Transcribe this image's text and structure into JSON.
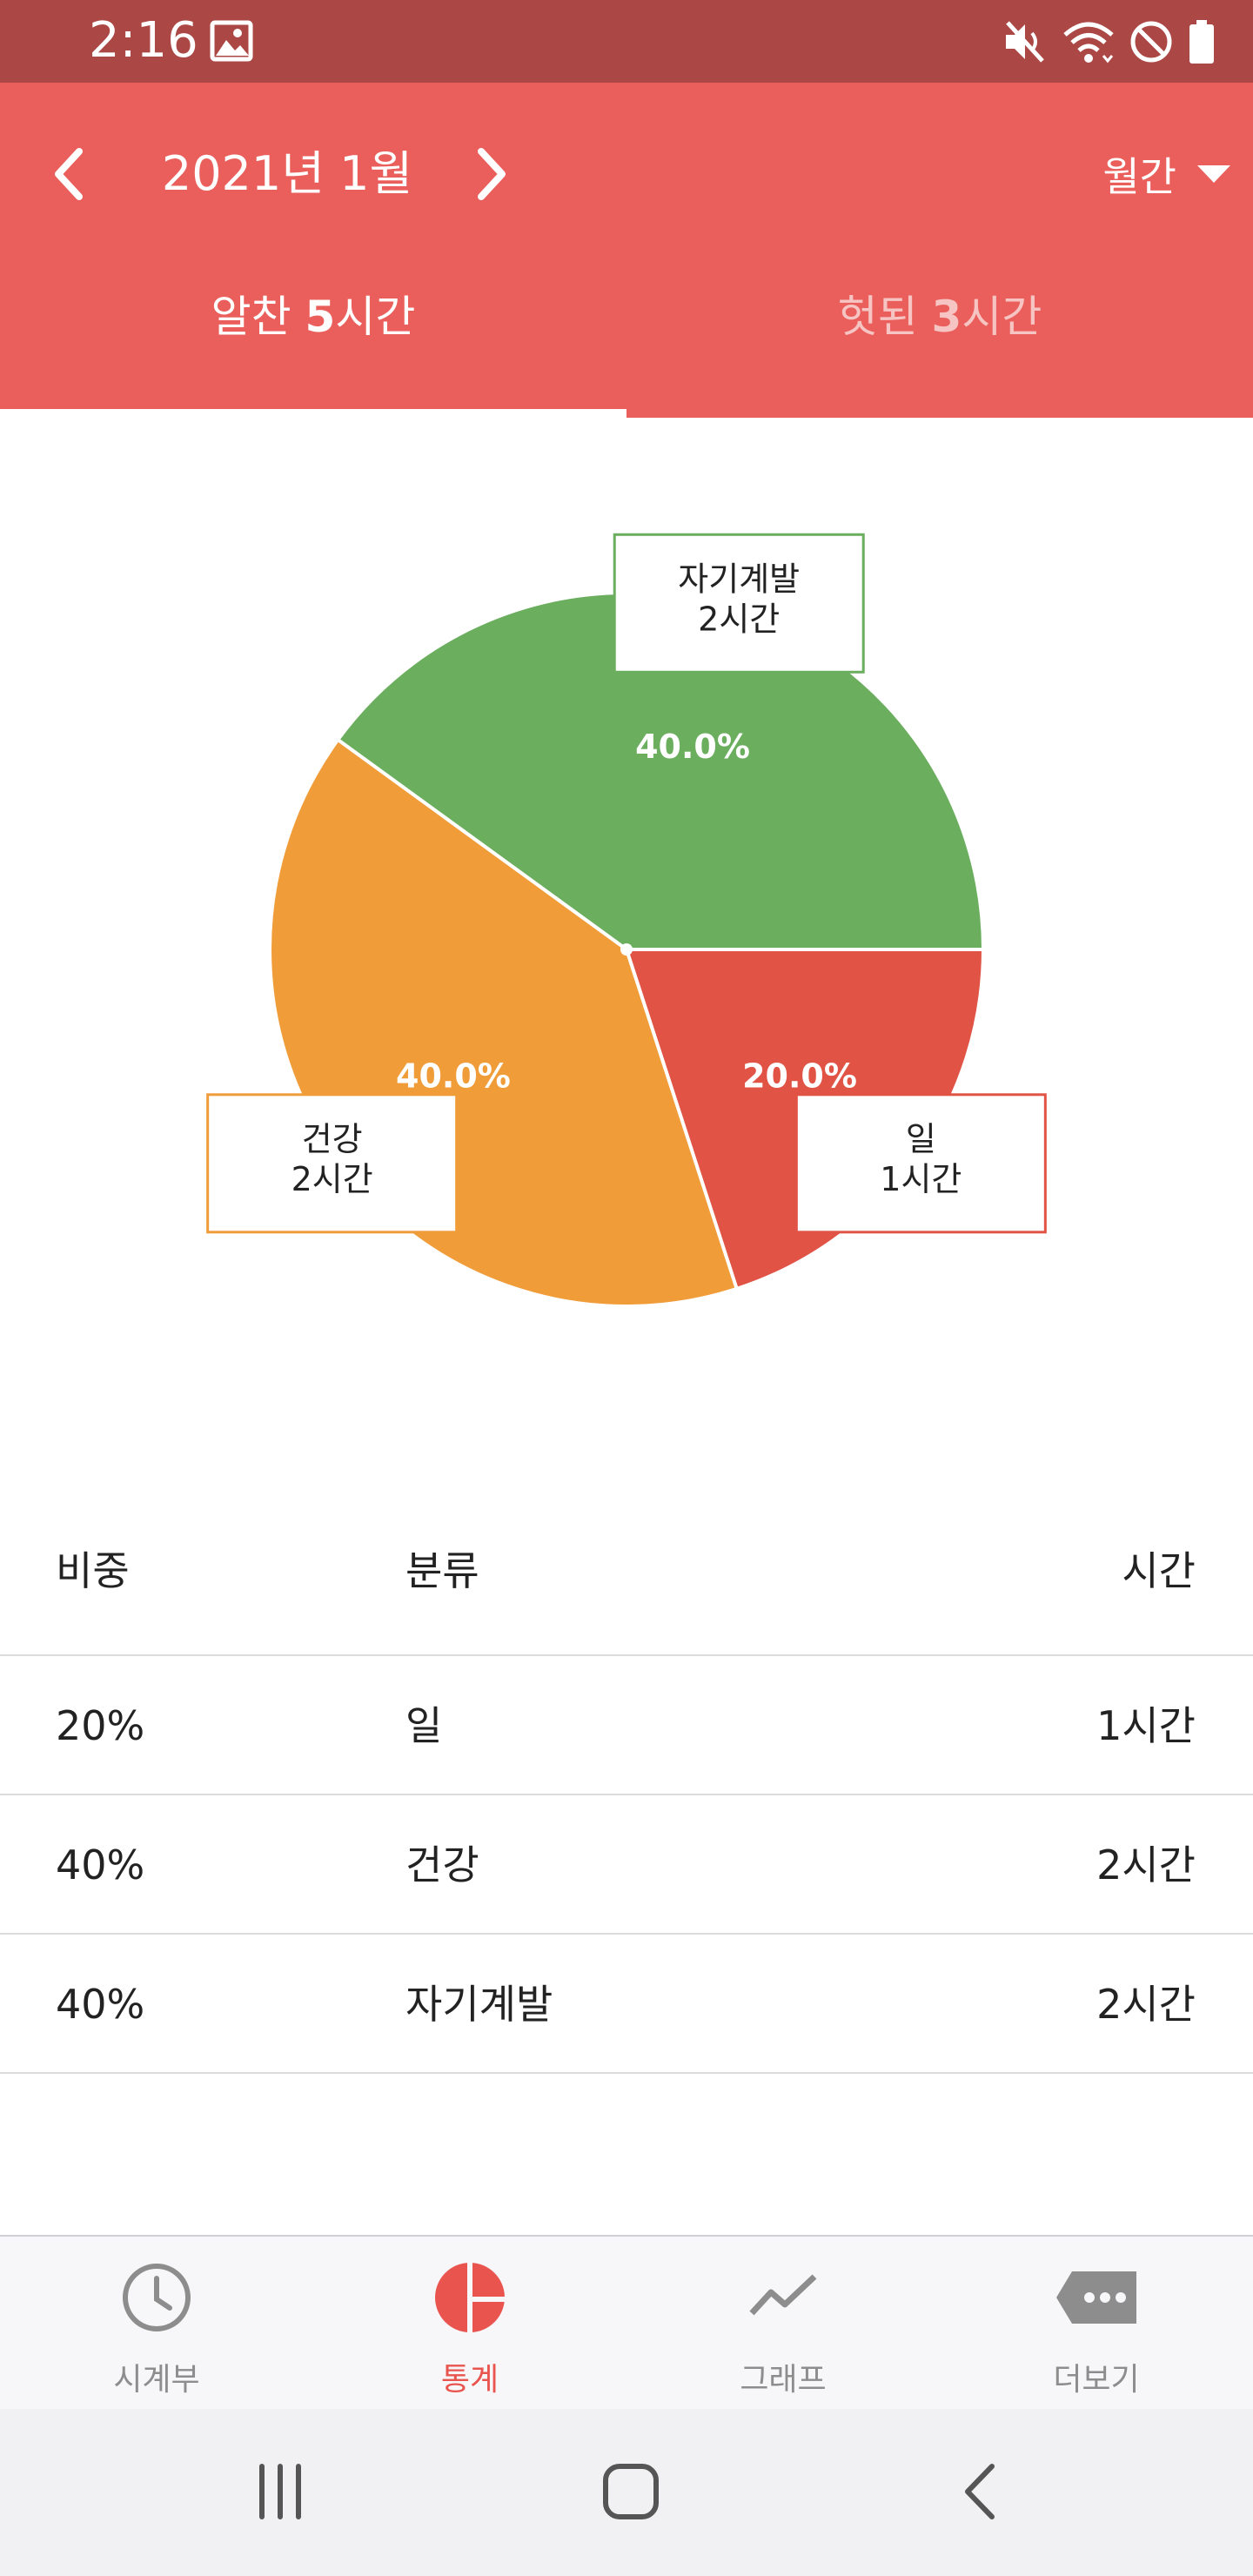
{
  "status_bar": {
    "time": "2:16",
    "icons": [
      "image-icon",
      "mute-icon",
      "wifi-icon",
      "do-not-disturb-icon",
      "battery-icon"
    ]
  },
  "header": {
    "month": "2021년 1월",
    "period_selector": "월간",
    "icons": [
      "chevron-left-icon",
      "chevron-right-icon",
      "dropdown-arrow-icon"
    ]
  },
  "tabs": [
    {
      "prefix": "알찬 ",
      "hours": "5",
      "suffix": "시간",
      "active": true
    },
    {
      "prefix": "헛된 ",
      "hours": "3",
      "suffix": "시간",
      "active": false
    }
  ],
  "chart_data": {
    "type": "pie",
    "slices": [
      {
        "label": "자기계발",
        "value_label": "2시간",
        "percent": 40.0,
        "percent_text": "40.0%",
        "color": "#6aae5e"
      },
      {
        "label": "일",
        "value_label": "1시간",
        "percent": 20.0,
        "percent_text": "20.0%",
        "color": "#e05345"
      },
      {
        "label": "건강",
        "value_label": "2시간",
        "percent": 40.0,
        "percent_text": "40.0%",
        "color": "#f09c38"
      }
    ]
  },
  "table": {
    "headers": [
      "비중",
      "분류",
      "시간"
    ],
    "rows": [
      [
        "20%",
        "일",
        "1시간"
      ],
      [
        "40%",
        "건강",
        "2시간"
      ],
      [
        "40%",
        "자기계발",
        "2시간"
      ]
    ]
  },
  "bottom_nav": [
    {
      "label": "시계부",
      "icon": "clock-icon",
      "active": false
    },
    {
      "label": "통계",
      "icon": "pie-chart-icon",
      "active": true
    },
    {
      "label": "그래프",
      "icon": "trend-line-icon",
      "active": false
    },
    {
      "label": "더보기",
      "icon": "more-icon",
      "active": false
    }
  ],
  "colors": {
    "status_bar": "#ab4744",
    "app_bar": "#ea5f5b",
    "active_nav": "#e9544f",
    "inactive_nav": "#8d8d8d"
  }
}
